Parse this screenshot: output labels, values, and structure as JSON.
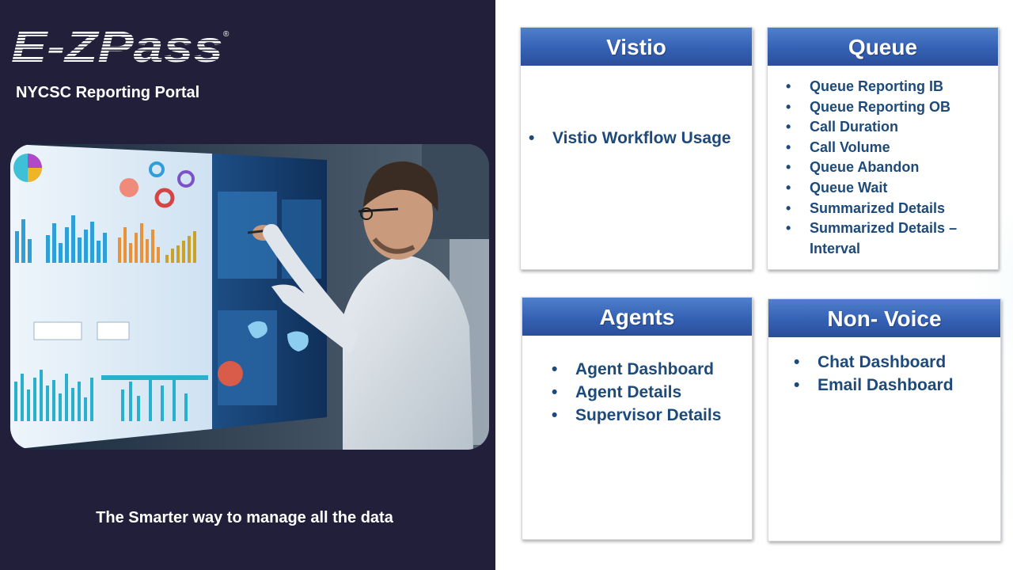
{
  "brand": {
    "logo_text": "E-ZPass",
    "registered_mark": "®"
  },
  "portal_title": "NYCSC Reporting Portal",
  "hero": {
    "description_icon": "person-at-dashboard-screen-image"
  },
  "tagline": "The Smarter way to manage all the data",
  "cards": {
    "vistio": {
      "title": "Vistio",
      "items": [
        "Vistio Workflow Usage"
      ]
    },
    "queue": {
      "title": "Queue",
      "items": [
        "Queue Reporting IB",
        "Queue Reporting OB",
        "Call Duration",
        "Call Volume",
        "Queue Abandon",
        "Queue Wait",
        "Summarized Details",
        "Summarized Details – Interval"
      ]
    },
    "agents": {
      "title": "Agents",
      "items": [
        "Agent Dashboard",
        "Agent Details",
        "Supervisor Details"
      ]
    },
    "nonvoice": {
      "title": "Non- Voice",
      "items": [
        "Chat Dashboard",
        "Email Dashboard"
      ]
    }
  },
  "colors": {
    "left_panel": "#221f3a",
    "header_blue": "#3561b4",
    "item_text": "#1d4a7a"
  }
}
